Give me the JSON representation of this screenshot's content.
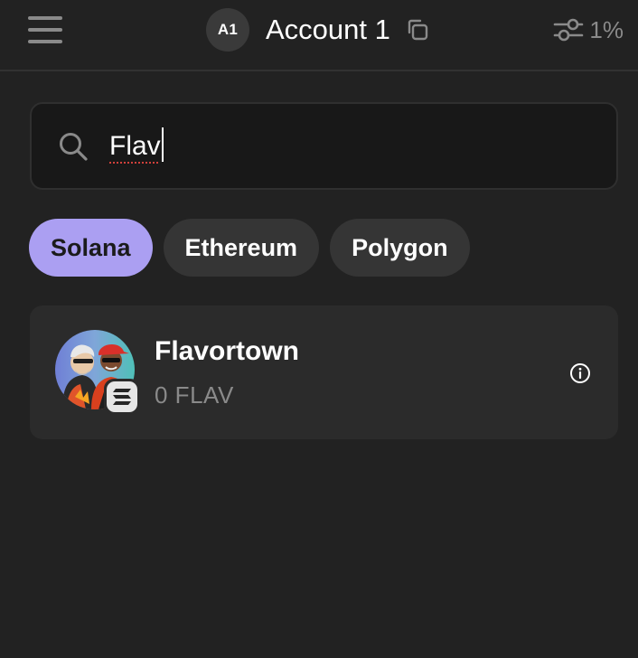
{
  "header": {
    "menu_icon": "hamburger-menu-icon",
    "account_avatar": "A1",
    "account_name": "Account 1",
    "copy_icon": "copy-icon",
    "settings_icon": "sliders-icon",
    "slippage": "1%"
  },
  "search": {
    "icon": "search-icon",
    "value": "Flav"
  },
  "chips": [
    {
      "label": "Solana",
      "active": true
    },
    {
      "label": "Ethereum",
      "active": false
    },
    {
      "label": "Polygon",
      "active": false
    }
  ],
  "results": [
    {
      "name": "Flavortown",
      "balance": "0 FLAV",
      "chain_badge_icon": "solana-icon",
      "info_icon": "info-icon"
    }
  ],
  "colors": {
    "background": "#222222",
    "accent": "#ab9ff2",
    "card": "#2b2b2b",
    "muted_text": "#8a8a8a"
  }
}
